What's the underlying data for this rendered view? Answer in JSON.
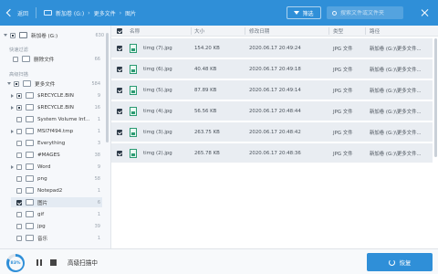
{
  "toolbar": {
    "back_label": "返回",
    "breadcrumb": [
      "新加卷 (G:)",
      "更多文件",
      "图片"
    ],
    "filter_label": "筛选",
    "search_placeholder": "搜索文件或文件夹"
  },
  "sidebar": {
    "drive": {
      "label": "新加卷 (G:)",
      "count": "630"
    },
    "quick_filter_label": "快速过滤",
    "deleted": {
      "label": "删除文件",
      "count": "66"
    },
    "advanced_label": "高级扫描",
    "more": {
      "label": "更多文件",
      "count": "584"
    },
    "items": [
      {
        "label": "$RECYCLE.BIN",
        "count": "9",
        "expand": true,
        "check": "partial"
      },
      {
        "label": "$RECYCLE.BIN",
        "count": "16",
        "expand": true,
        "check": "partial"
      },
      {
        "label": "System Volume Inf...",
        "count": "1",
        "expand": false,
        "check": "none"
      },
      {
        "label": "MSI7f494.tmp",
        "count": "1",
        "expand": true,
        "check": "none"
      },
      {
        "label": "Everything",
        "count": "3",
        "expand": false,
        "check": "none"
      },
      {
        "label": "#MAGES",
        "count": "38",
        "expand": false,
        "check": "none"
      },
      {
        "label": "Word",
        "count": "9",
        "expand": true,
        "check": "none"
      },
      {
        "label": "png",
        "count": "58",
        "expand": false,
        "check": "none"
      },
      {
        "label": "Notepad2",
        "count": "1",
        "expand": false,
        "check": "none"
      },
      {
        "label": "图片",
        "count": "6",
        "expand": false,
        "check": "checked"
      },
      {
        "label": "gif",
        "count": "1",
        "expand": false,
        "check": "none"
      },
      {
        "label": "jpg",
        "count": "39",
        "expand": false,
        "check": "none"
      },
      {
        "label": "音乐",
        "count": "1",
        "expand": false,
        "check": "none"
      }
    ]
  },
  "table": {
    "headers": [
      "名称",
      "大小",
      "修改日期",
      "类型",
      "路径"
    ],
    "rows": [
      {
        "name": "timg (7).jpg",
        "size": "154.20 KB",
        "date": "2020.06.17 20:49:24",
        "type": "JPG 文件",
        "path": "新加卷 (G:)\\更多文件..."
      },
      {
        "name": "timg (6).jpg",
        "size": "40.48 KB",
        "date": "2020.06.17 20:49:18",
        "type": "JPG 文件",
        "path": "新加卷 (G:)\\更多文件..."
      },
      {
        "name": "timg (5).jpg",
        "size": "87.89 KB",
        "date": "2020.06.17 20:49:14",
        "type": "JPG 文件",
        "path": "新加卷 (G:)\\更多文件..."
      },
      {
        "name": "timg (4).jpg",
        "size": "56.56 KB",
        "date": "2020.06.17 20:48:44",
        "type": "JPG 文件",
        "path": "新加卷 (G:)\\更多文件..."
      },
      {
        "name": "timg (3).jpg",
        "size": "263.75 KB",
        "date": "2020.06.17 20:48:42",
        "type": "JPG 文件",
        "path": "新加卷 (G:)\\更多文件..."
      },
      {
        "name": "timg (2).jpg",
        "size": "265.78 KB",
        "date": "2020.06.17 20:48:36",
        "type": "JPG 文件",
        "path": "新加卷 (G:)\\更多文件..."
      }
    ]
  },
  "footer": {
    "progress_label": "83%",
    "progress_value": 0.83,
    "status": "高级扫描中",
    "recover_label": "恢复"
  },
  "colors": {
    "accent": "#2f8fd8",
    "file_icon": "#2a9a72"
  }
}
